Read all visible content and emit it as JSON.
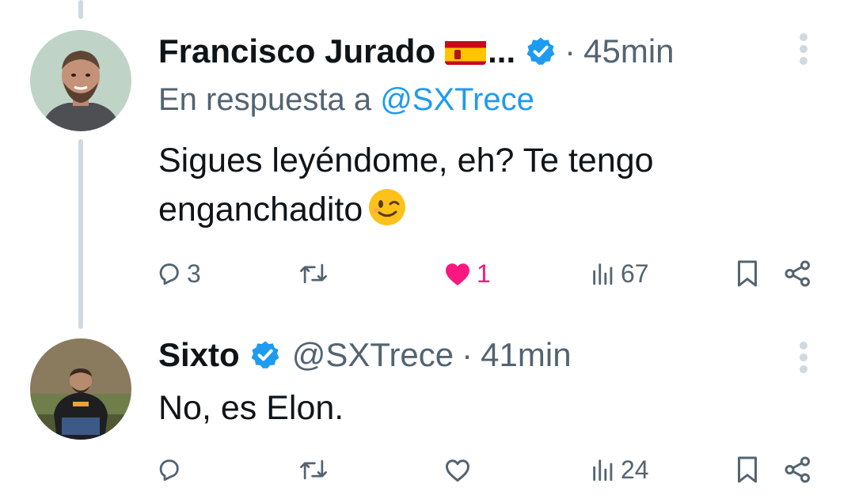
{
  "tweets": [
    {
      "author_name": "Francisco Jurado",
      "truncation": "...",
      "separator": "·",
      "time": "45min",
      "reply_prefix": "En respuesta a",
      "reply_to_handle": "@SXTrece",
      "text_line1": "Sigues leyéndome, eh? Te tengo",
      "text_line2": "enganchadito",
      "icons": [
        "spain-flag-emoji",
        "verified-badge-icon",
        "winking-face-emoji"
      ],
      "actions": {
        "replies": "3",
        "retweets": "",
        "likes": "1",
        "liked": true,
        "views": "67"
      }
    },
    {
      "author_name": "Sixto",
      "handle": "@SXTrece",
      "separator": "·",
      "time": "41min",
      "text_line1": "No, es Elon.",
      "icons": [
        "verified-badge-icon"
      ],
      "actions": {
        "replies": "",
        "retweets": "",
        "likes": "",
        "liked": false,
        "views": "24"
      }
    }
  ],
  "colors": {
    "accent": "#1d9bf0",
    "like": "#f91880",
    "muted": "#536471",
    "thread_line": "#cfd9de"
  }
}
